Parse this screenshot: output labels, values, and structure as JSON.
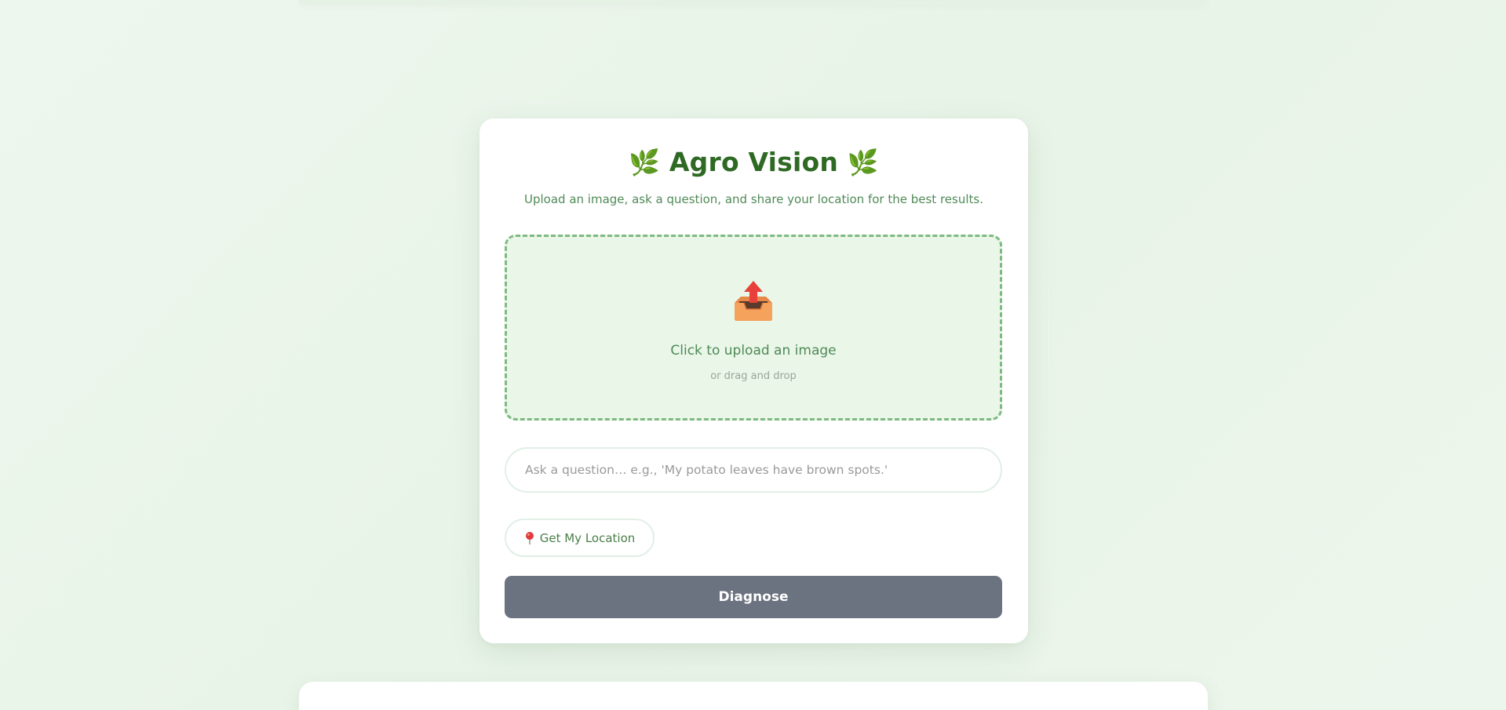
{
  "app": {
    "title": "Agro Vision",
    "title_leaf_left": "🌿",
    "title_leaf_right": "🌿",
    "subtitle": "Upload an image, ask a question, and share your location for the best results."
  },
  "upload": {
    "icon": "inbox-tray-upload-icon",
    "main_text": "Click to upload an image",
    "sub_text": "or drag and drop"
  },
  "question": {
    "placeholder": "Ask a question… e.g., 'My potato leaves have brown spots.'",
    "value": ""
  },
  "location": {
    "icon": "map-pin-icon",
    "label": "Get My Location"
  },
  "diagnose": {
    "label": "Diagnose"
  },
  "colors": {
    "accent": "#2e6a24",
    "dropzone_bg": "#eaf6e8",
    "dropzone_border": "#7dba80",
    "button_bg": "#6b7280"
  }
}
